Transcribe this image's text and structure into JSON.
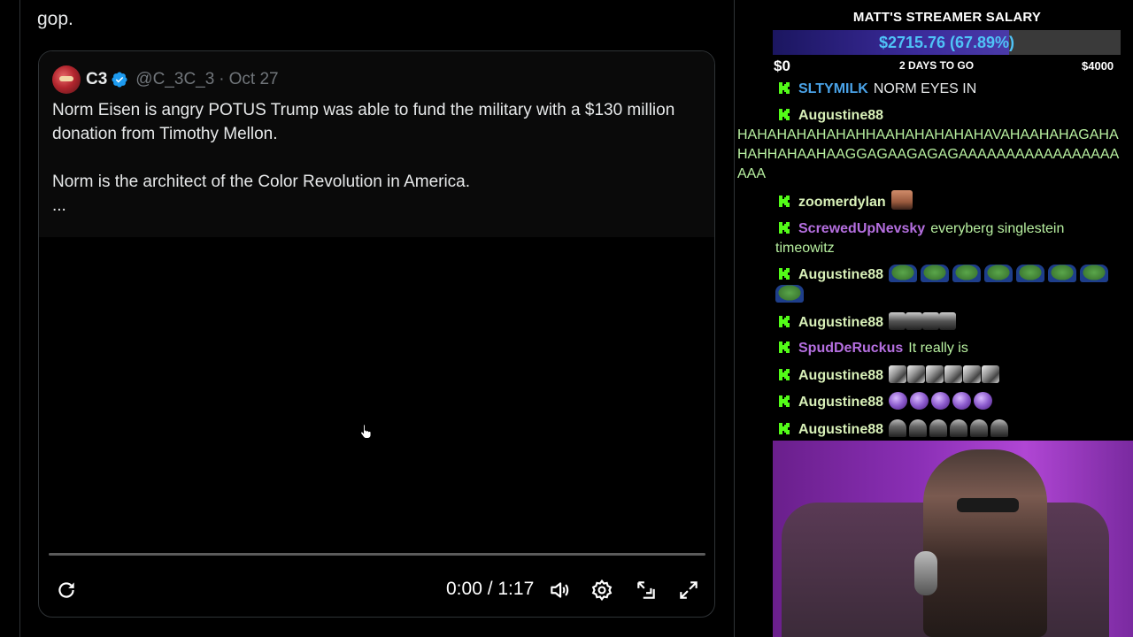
{
  "post": {
    "top_text": "gop."
  },
  "quote": {
    "name": "C3",
    "handle": "@C_3C_3",
    "separator": "·",
    "date": "Oct 27",
    "line1": "Norm Eisen is angry POTUS Trump was able to fund the military with a $130 million donation from Timothy Mellon.",
    "line2": "Norm is the architect of the Color Revolution in America.",
    "line3": "..."
  },
  "video": {
    "time": "0:00 / 1:17",
    "progress": 0.0
  },
  "icons": {
    "replay": "replay-icon",
    "volume": "volume-icon",
    "settings": "gear-icon",
    "popout": "popout-icon",
    "fullscreen": "fullscreen-icon",
    "verified": "verified-badge-icon",
    "chat_badge": "kick-badge-icon"
  },
  "salary": {
    "title": "MATT'S STREAMER SALARY",
    "amount": "$2715.76 (67.89%)",
    "fraction": 0.6789,
    "min": "$0",
    "days_left": "2 DAYS TO GO",
    "max": "$4000"
  },
  "chat": [
    {
      "user": "SLTYMILK",
      "color": "#4aa3e8",
      "text": "NORM EYES IN",
      "emotes": []
    },
    {
      "user": "Augustine88",
      "color": "#d8f0b8",
      "text": "HAHAHAHAHAHAHHAAHAHAHAHAHAVAHAAHAHAGAHAHAHHAHAAHAAGGAGAAGAGAGAAAAAAAAAAAAAAAAAAAA",
      "emotes": [],
      "wrap": true
    },
    {
      "user": "zoomerdylan",
      "color": "#d8f0b8",
      "text": "",
      "emotes": [
        "face"
      ]
    },
    {
      "user": "ScrewedUpNevsky",
      "color": "#b56fe0",
      "text": "everyberg singlestein timeowitz",
      "text_color": "#b8f0a0",
      "emotes": []
    },
    {
      "user": "Augustine88",
      "color": "#d8f0b8",
      "text": "",
      "emotes": [
        "pepe",
        "pepe",
        "pepe",
        "pepe",
        "pepe",
        "pepe",
        "pepe",
        "pepe"
      ]
    },
    {
      "user": "Augustine88",
      "color": "#d8f0b8",
      "text": "",
      "emotes": [
        "crowd",
        "crowd",
        "crowd",
        "crowd"
      ]
    },
    {
      "user": "SpudDeRuckus",
      "color": "#b56fe0",
      "text": "It really is",
      "text_color": "#b8f0a0",
      "emotes": []
    },
    {
      "user": "Augustine88",
      "color": "#d8f0b8",
      "text": "",
      "emotes": [
        "knife",
        "knife",
        "knife",
        "knife",
        "knife",
        "knife"
      ]
    },
    {
      "user": "Augustine88",
      "color": "#d8f0b8",
      "text": "",
      "emotes": [
        "orb",
        "orb",
        "orb",
        "orb",
        "orb"
      ]
    },
    {
      "user": "Augustine88",
      "color": "#d8f0b8",
      "text": "",
      "emotes": [
        "figure",
        "figure",
        "figure",
        "figure",
        "figure",
        "figure"
      ]
    }
  ],
  "colors": {
    "background": "#000000",
    "border": "#2f3336",
    "text": "#e7e9ea",
    "muted": "#71767b",
    "verified": "#1d9bf0",
    "kick_green": "#53fc18",
    "salary_amount": "#4fc3f7"
  }
}
